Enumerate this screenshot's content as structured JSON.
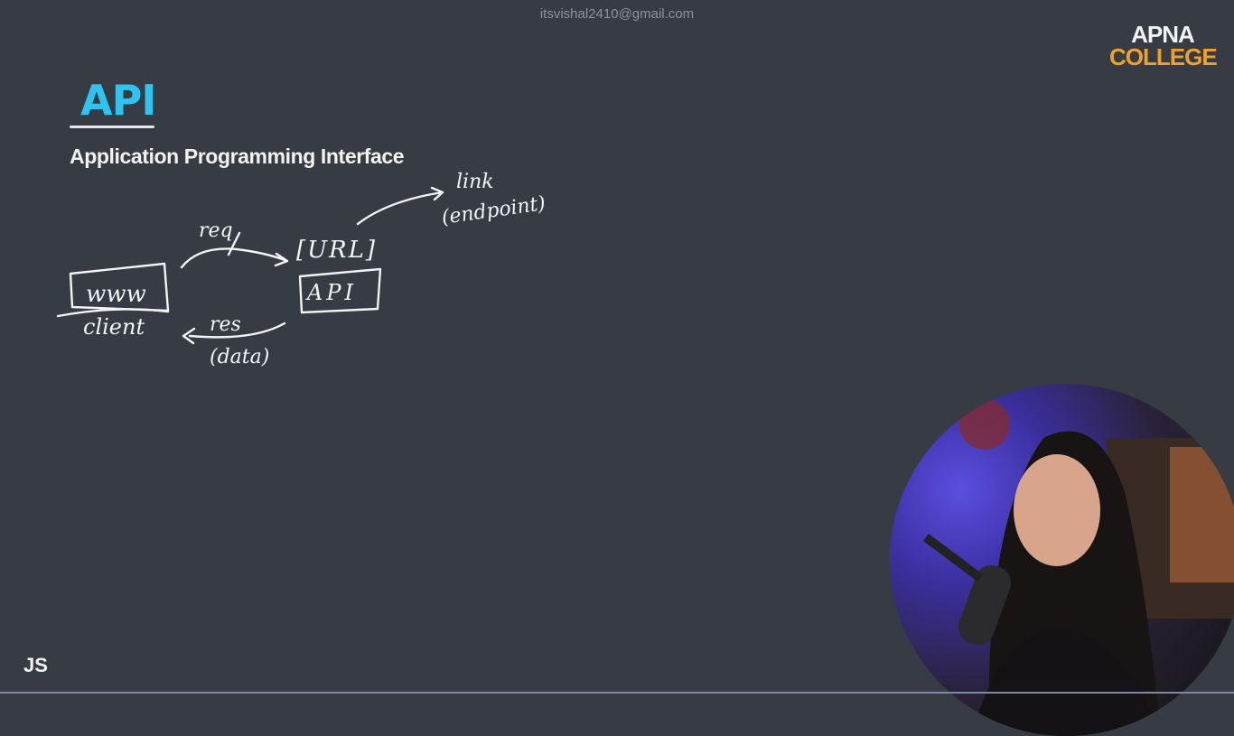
{
  "header": {
    "email": "itsvishal2410@gmail.com"
  },
  "logo": {
    "line1": "APNA",
    "line2": "COLLEGE"
  },
  "slide": {
    "title": "API",
    "subtitle": "Application Programming Interface",
    "footer_label": "JS"
  },
  "diagram": {
    "client_box": "www",
    "client_label": "client",
    "req_label": "req",
    "url_label": "[URL]",
    "api_box": "API",
    "res_label": "res",
    "data_label": "(data)",
    "link_label": "link",
    "endpoint_label": "(endpoint)"
  },
  "colors": {
    "background": "#363b44",
    "title": "#2fc3ef",
    "logo_accent": "#f0a12a"
  }
}
